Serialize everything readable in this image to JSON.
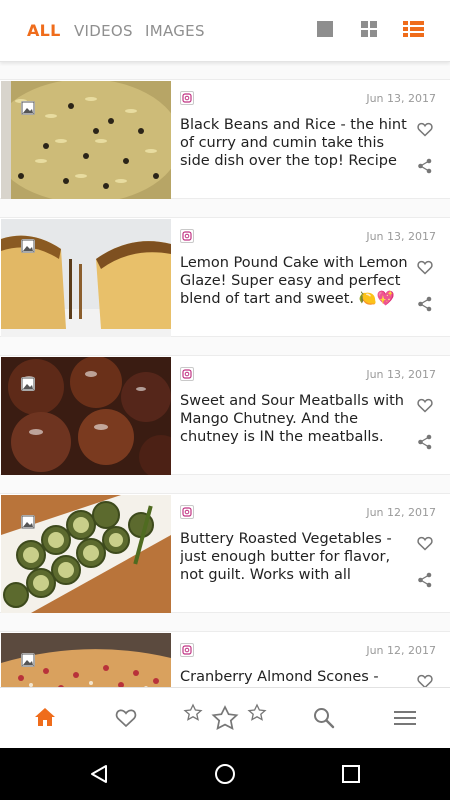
{
  "tabs": [
    {
      "label": "ALL",
      "active": true
    },
    {
      "label": "VIDEOS",
      "active": false
    },
    {
      "label": "IMAGES",
      "active": false
    }
  ],
  "view_modes": [
    "single-view-icon",
    "grid-view-icon",
    "list-view-icon"
  ],
  "active_view": "list-view-icon",
  "colors": {
    "accent": "#ef6c1b",
    "instagram": "#c13584"
  },
  "posts": [
    {
      "source": "instagram",
      "date": "Jun 13, 2017",
      "text": "Black Beans and Rice - the hint of curry and cumin take this side dish over the top! Recipe soon o..."
    },
    {
      "source": "instagram",
      "date": "Jun 13, 2017",
      "text": "Lemon Pound Cake with Lemon Glaze! Super easy and perfect blend of tart and sweet. 🍋💖Re..."
    },
    {
      "source": "instagram",
      "date": "Jun 13, 2017",
      "text": "Sweet and Sour Meatballs with Mango Chutney. And the chutney is IN the meatballs. Flavor explo..."
    },
    {
      "source": "instagram",
      "date": "Jun 12, 2017",
      "text": "Buttery Roasted Vegetables - just enough butter for flavor, not guilt. Works with all summer veggies! ..."
    },
    {
      "source": "instagram",
      "date": "Jun 12, 2017",
      "text": "Cranberry Almond Scones -"
    }
  ],
  "bottom_nav": [
    "home-icon",
    "heart-icon",
    "rating-stars-icon",
    "search-icon",
    "menu-icon"
  ],
  "system_nav": [
    "back-icon",
    "home-circle-icon",
    "recents-icon"
  ]
}
